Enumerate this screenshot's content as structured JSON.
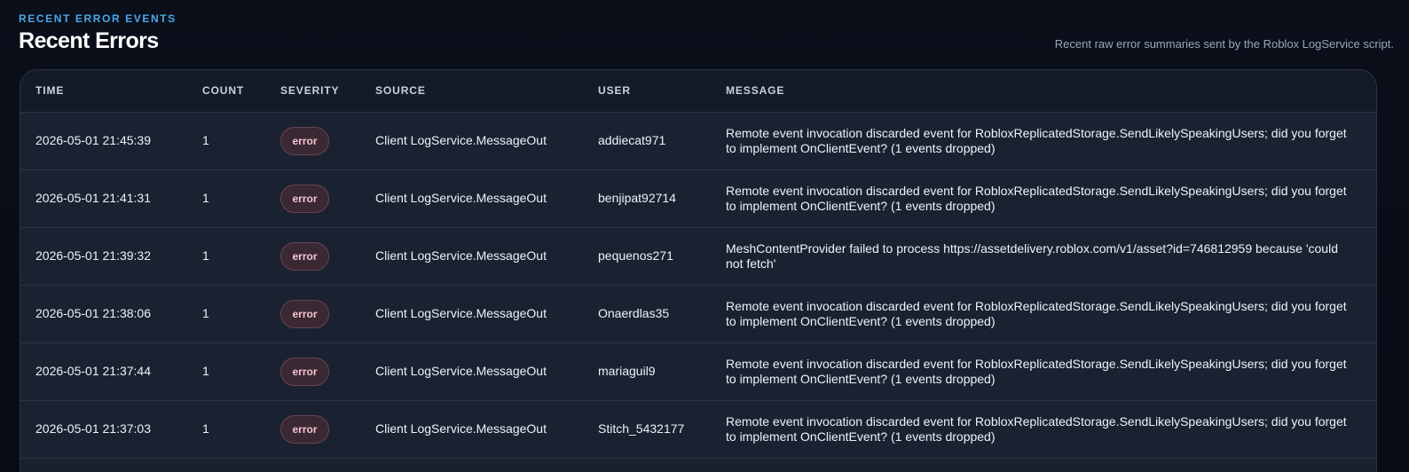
{
  "header": {
    "eyebrow": "RECENT ERROR EVENTS",
    "title": "Recent Errors",
    "subtitle": "Recent raw error summaries sent by the Roblox LogService script."
  },
  "table": {
    "columns": [
      "TIME",
      "COUNT",
      "SEVERITY",
      "SOURCE",
      "USER",
      "MESSAGE"
    ],
    "rows": [
      {
        "time": "2026-05-01 21:45:39",
        "count": "1",
        "severity": "error",
        "source": "Client LogService.MessageOut",
        "user": "addiecat971",
        "message": "Remote event invocation discarded event for RobloxReplicatedStorage.SendLikelySpeakingUsers; did you forget to implement OnClientEvent? (1 events dropped)"
      },
      {
        "time": "2026-05-01 21:41:31",
        "count": "1",
        "severity": "error",
        "source": "Client LogService.MessageOut",
        "user": "benjipat92714",
        "message": "Remote event invocation discarded event for RobloxReplicatedStorage.SendLikelySpeakingUsers; did you forget to implement OnClientEvent? (1 events dropped)"
      },
      {
        "time": "2026-05-01 21:39:32",
        "count": "1",
        "severity": "error",
        "source": "Client LogService.MessageOut",
        "user": "pequenos271",
        "message": "MeshContentProvider failed to process https://assetdelivery.roblox.com/v1/asset?id=746812959 because 'could not fetch'"
      },
      {
        "time": "2026-05-01 21:38:06",
        "count": "1",
        "severity": "error",
        "source": "Client LogService.MessageOut",
        "user": "Onaerdlas35",
        "message": "Remote event invocation discarded event for RobloxReplicatedStorage.SendLikelySpeakingUsers; did you forget to implement OnClientEvent? (1 events dropped)"
      },
      {
        "time": "2026-05-01 21:37:44",
        "count": "1",
        "severity": "error",
        "source": "Client LogService.MessageOut",
        "user": "mariaguil9",
        "message": "Remote event invocation discarded event for RobloxReplicatedStorage.SendLikelySpeakingUsers; did you forget to implement OnClientEvent? (1 events dropped)"
      },
      {
        "time": "2026-05-01 21:37:03",
        "count": "1",
        "severity": "error",
        "source": "Client LogService.MessageOut",
        "user": "Stitch_5432177",
        "message": "Remote event invocation discarded event for RobloxReplicatedStorage.SendLikelySpeakingUsers; did you forget to implement OnClientEvent? (1 events dropped)"
      }
    ]
  },
  "colors": {
    "accent": "#4aa8e8",
    "background": "#080d17",
    "table_bg": "#1a2231",
    "error_badge_bg": "#3a2833",
    "error_badge_text": "#f3c4d0"
  }
}
